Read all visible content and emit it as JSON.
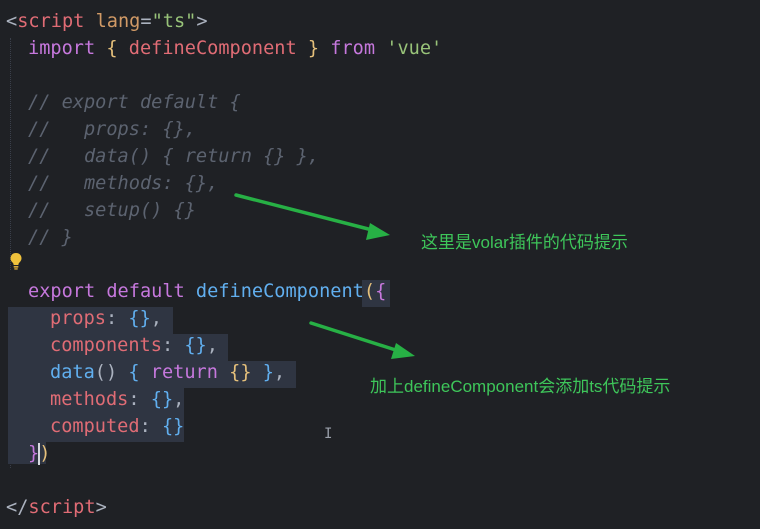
{
  "editor": {
    "lines": {
      "l1": {
        "open": "<",
        "tag": "script",
        "attr": " lang",
        "eq": "=",
        "val": "\"ts\"",
        "close": ">"
      },
      "l2": {
        "kw1": "import",
        "b1": "{",
        "name": " defineComponent ",
        "b2": "}",
        "kw2": " from",
        "str": " 'vue'"
      },
      "c1": "// export default {",
      "c2": "//   props: {},",
      "c3": "//   data() { return {} },",
      "c4": "//   methods: {},",
      "c5": "//   setup() {}",
      "c6": "// }",
      "l10": {
        "kw1": "export",
        "kw2": " default",
        "fn": " defineComponent",
        "p": "(",
        "b": "{"
      },
      "l11": {
        "prop": "props",
        "colon": ": ",
        "val": "{}",
        "comma": ","
      },
      "l12": {
        "prop": "components",
        "colon": ": ",
        "val": "{}",
        "comma": ","
      },
      "l13": {
        "fn": "data",
        "paren": "()",
        "b1": " {",
        "kw": " return",
        "val": " {}",
        "b2": " }",
        "comma": ","
      },
      "l14": {
        "prop": "methods",
        "colon": ": ",
        "val": "{}",
        "comma": ","
      },
      "l15": {
        "prop": "computed",
        "colon": ": ",
        "val": "{}"
      },
      "l16": {
        "b": "}",
        "p": ")"
      },
      "l18": {
        "open": "</",
        "tag": "script",
        "close": ">"
      }
    }
  },
  "annotations": {
    "volar_hint": "这里是volar插件的代码提示",
    "define_hint": "加上defineComponent会添加ts代码提示"
  },
  "icons": {
    "lightbulb": "lightbulb-icon",
    "text_cursor": "text-cursor-icon"
  },
  "colors": {
    "background": "#1f2125",
    "annotation": "#3ec65a"
  }
}
